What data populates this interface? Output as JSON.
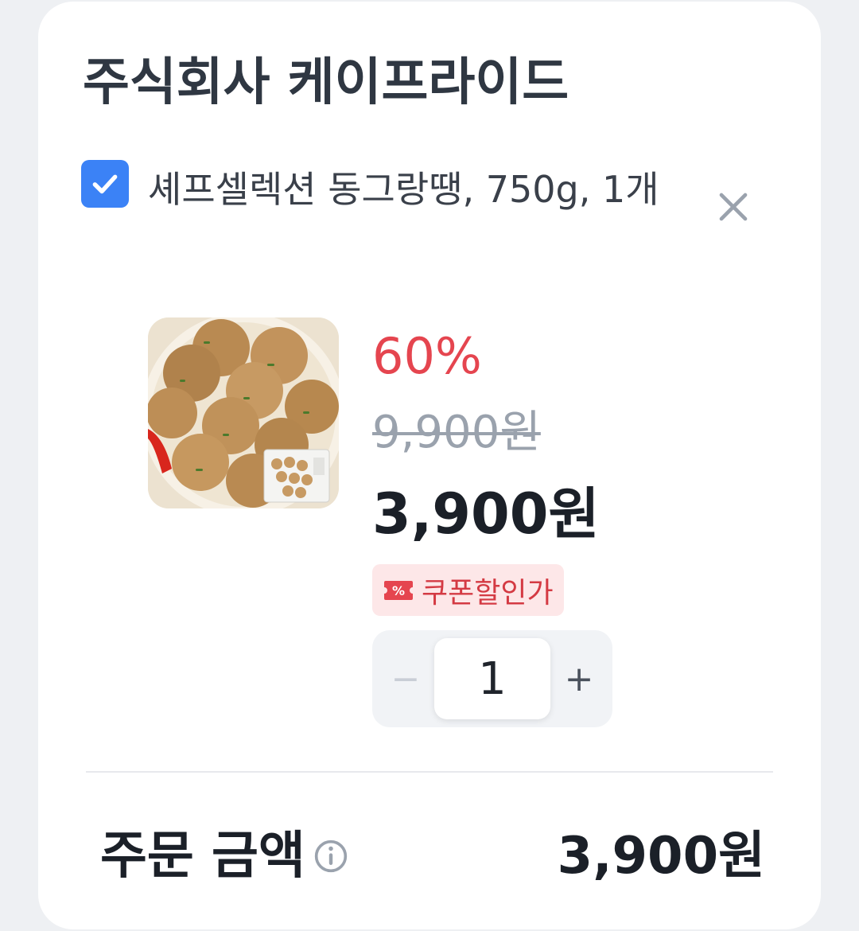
{
  "seller": {
    "name": "주식회사 케이프라이드"
  },
  "item": {
    "checked": true,
    "name": "셰프셀렉션 동그랑땡, 750g, 1개",
    "discount_rate": "60%",
    "original_price": "9,900원",
    "sale_price": "3,900원",
    "coupon_label": "쿠폰할인가",
    "coupon_icon_text": "%",
    "quantity": "1",
    "minus_label": "−",
    "plus_label": "+"
  },
  "icons": {
    "checkbox": "check-icon",
    "remove": "close-icon",
    "coupon": "coupon-icon",
    "info": "info-icon"
  },
  "summary": {
    "label": "주문 금액",
    "total": "3,900원"
  },
  "colors": {
    "accent": "#3b82f6",
    "discount": "#e5454f",
    "coupon_bg": "#fde7e8",
    "text_dark": "#1b2028"
  }
}
